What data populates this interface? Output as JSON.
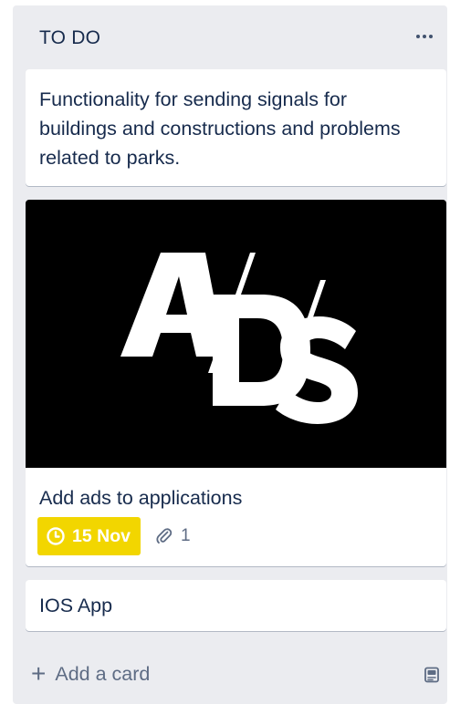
{
  "list": {
    "title": "TO DO",
    "menu_icon": "more-horizontal-icon"
  },
  "cards": [
    {
      "title": "Functionality for sending signals for buildings and constructions and problems related to parks."
    },
    {
      "title": "Add ads to applications",
      "cover": {
        "logo_text": "ADS",
        "background": "#000000",
        "foreground": "#ffffff"
      },
      "due_badge": {
        "icon": "clock-icon",
        "label": "15 Nov",
        "color": "#f2d600"
      },
      "attachment_badge": {
        "icon": "paperclip-icon",
        "count": "1"
      }
    },
    {
      "title": "IOS App"
    }
  ],
  "composer": {
    "add_label": "Add a card",
    "add_icon": "plus-icon",
    "template_icon": "card-template-icon"
  },
  "colors": {
    "list_background": "#ebecf0",
    "card_background": "#ffffff",
    "text": "#172b4d",
    "muted_text": "#5e6c84",
    "due_soon": "#f2d600"
  }
}
